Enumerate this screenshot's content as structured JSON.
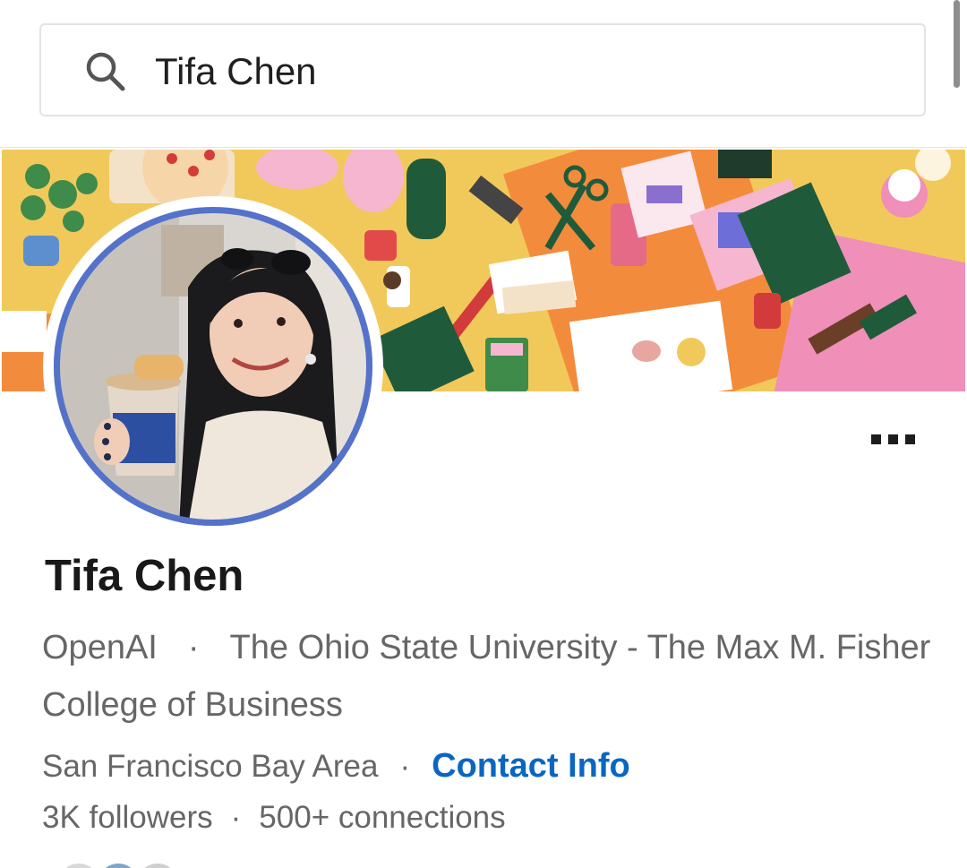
{
  "search": {
    "query": "Tifa Chen"
  },
  "profile": {
    "name": "Tifa Chen",
    "headline_company": "OpenAI",
    "headline_separator": "·",
    "headline_school": "The Ohio State University - The Max M. Fisher College of Business",
    "location": "San Francisco Bay Area",
    "location_separator": "·",
    "contact_info_label": "Contact Info",
    "followers": "3K followers",
    "stats_separator": "·",
    "connections": "500+ connections"
  },
  "icons": {
    "search": "search-icon",
    "more": "more-horizontal-icon"
  },
  "colors": {
    "link_blue": "#0a66c2",
    "avatar_ring": "#5472c9",
    "banner_yellow": "#f1c95b",
    "banner_orange": "#f38b3c",
    "banner_pink": "#f08fb7",
    "banner_green": "#1f5b3a"
  }
}
